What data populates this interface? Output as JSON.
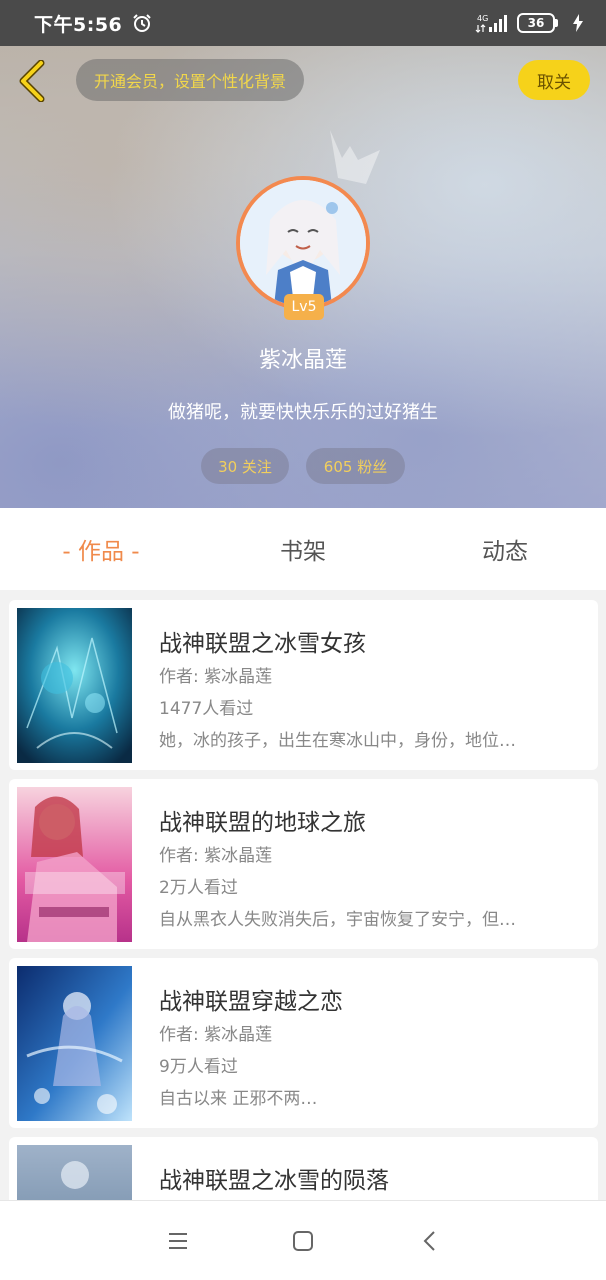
{
  "status_bar": {
    "time": "下午5:56",
    "network": "4G",
    "battery": "36"
  },
  "header": {
    "vip_banner": "开通会员，设置个性化背景",
    "unfollow_label": "取关",
    "level": "Lv5",
    "username": "紫冰晶莲",
    "bio": "做猪呢，就要快快乐乐的过好猪生",
    "following": "30 关注",
    "fans": "605 粉丝"
  },
  "tabs": [
    {
      "label": "- 作品 -",
      "active": true
    },
    {
      "label": "书架",
      "active": false
    },
    {
      "label": "动态",
      "active": false
    }
  ],
  "works": [
    {
      "title": "战神联盟之冰雪女孩",
      "author": "作者: 紫冰晶莲",
      "views": "1477人看过",
      "desc": "她，冰的孩子，出生在寒冰山中，身份，地位…"
    },
    {
      "title": "战神联盟的地球之旅",
      "author": "作者: 紫冰晶莲",
      "views": "2万人看过",
      "desc": "自从黑衣人失败消失后，宇宙恢复了安宁，但…"
    },
    {
      "title": "战神联盟穿越之恋",
      "author": "作者: 紫冰晶莲",
      "views": "9万人看过",
      "desc": "自古以来 正邪不两…"
    },
    {
      "title": "战神联盟之冰雪的陨落",
      "author": "",
      "views": "",
      "desc": ""
    }
  ],
  "colors": {
    "accent": "#f08a4b",
    "unfollow_bg": "#f6d21a",
    "vip_text": "#f2d74a"
  }
}
